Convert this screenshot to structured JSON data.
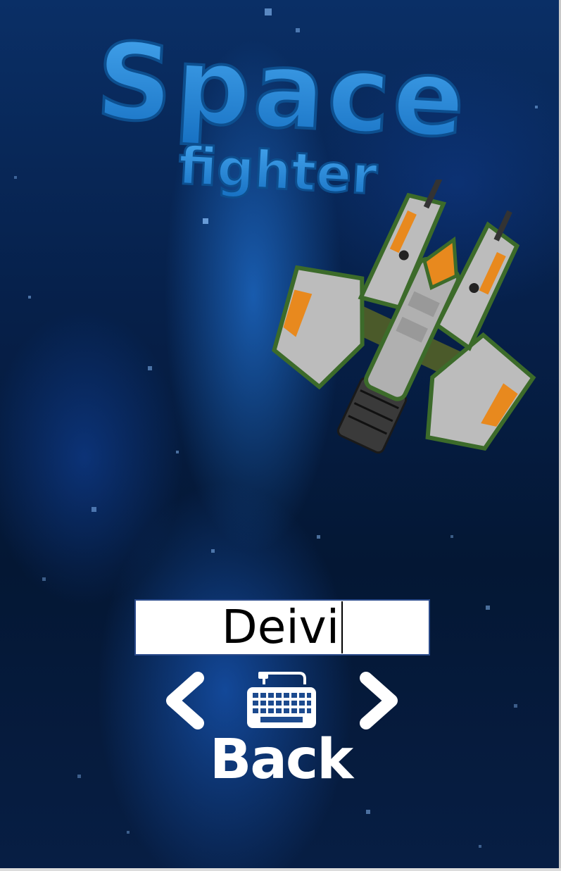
{
  "game": {
    "logo_line1": "Space",
    "logo_line2": "fighter"
  },
  "name_entry": {
    "value": "Deivi"
  },
  "controls": {
    "prev_icon": "chevron-left-icon",
    "keyboard_icon": "keyboard-icon",
    "next_icon": "chevron-right-icon",
    "back_label": "Back"
  },
  "colors": {
    "logo_blue": "#1f86d6",
    "background_blue": "#06204a",
    "ship_gray": "#b9b9b9",
    "ship_green": "#3c6b2a",
    "ship_orange": "#e8891e",
    "button_white": "#ffffff"
  }
}
